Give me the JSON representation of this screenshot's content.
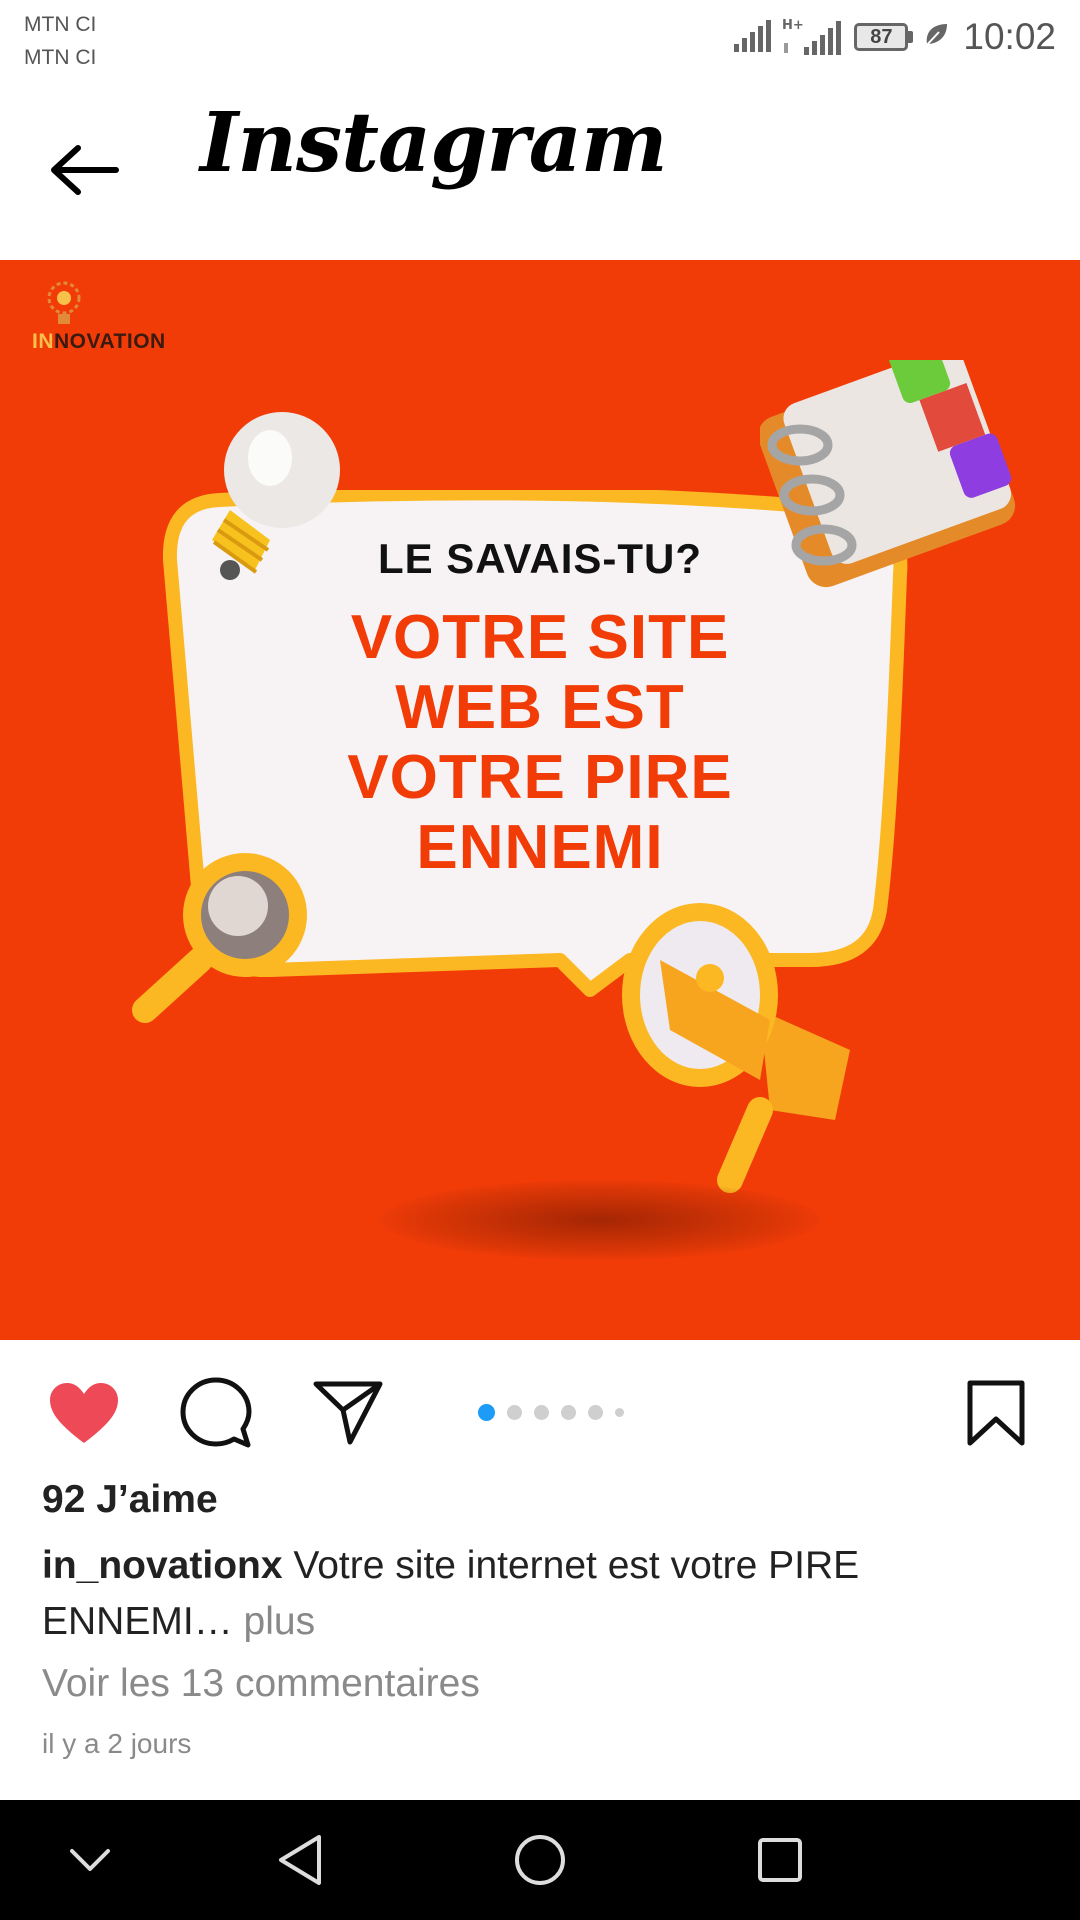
{
  "status_bar": {
    "carrier_1": "MTN CI",
    "carrier_2": "MTN CI",
    "network_type": "H+",
    "battery": "87",
    "time": "10:02"
  },
  "header": {
    "title": "Instagram",
    "back_icon": "arrow-left-icon"
  },
  "post": {
    "image": {
      "logo_text_prefix": "IN",
      "logo_text_suffix": "NOVATION",
      "subtitle": "LE SAVAIS-TU?",
      "headline_lines": [
        "VOTRE SITE",
        "WEB EST",
        "VOTRE PIRE",
        "ENNEMI"
      ],
      "background_color": "#f23c08",
      "accent_color": "#fbb823"
    },
    "carousel": {
      "count": 6,
      "active_index": 0
    },
    "actions": {
      "like_icon": "heart-filled-icon",
      "comment_icon": "comment-icon",
      "share_icon": "send-icon",
      "save_icon": "bookmark-icon",
      "liked": true,
      "like_color": "#ed4956"
    },
    "likes_text": "92 J’aime",
    "caption": {
      "username": "in_novationx",
      "text": " Votre site internet est votre PIRE ENNEMI",
      "ellipsis": "… ",
      "more_label": "plus"
    },
    "comments_link": "Voir les 13 commentaires",
    "timestamp": "il y a 2 jours"
  },
  "nav_bar": {
    "collapse_icon": "chevron-down-icon",
    "back_icon": "triangle-back-icon",
    "home_icon": "circle-home-icon",
    "recents_icon": "square-recents-icon"
  }
}
